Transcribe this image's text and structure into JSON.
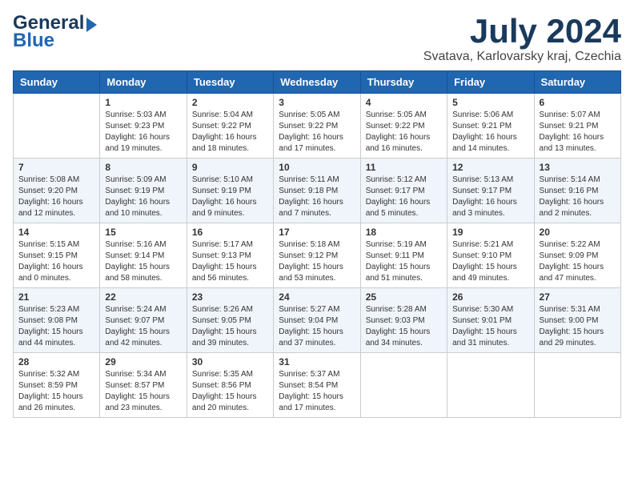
{
  "header": {
    "logo_line1": "General",
    "logo_line2": "Blue",
    "title": "July 2024",
    "subtitle": "Svatava, Karlovarsky kraj, Czechia"
  },
  "days_of_week": [
    "Sunday",
    "Monday",
    "Tuesday",
    "Wednesday",
    "Thursday",
    "Friday",
    "Saturday"
  ],
  "weeks": [
    [
      {
        "day": "",
        "sunrise": "",
        "sunset": "",
        "daylight": ""
      },
      {
        "day": "1",
        "sunrise": "Sunrise: 5:03 AM",
        "sunset": "Sunset: 9:23 PM",
        "daylight": "Daylight: 16 hours and 19 minutes."
      },
      {
        "day": "2",
        "sunrise": "Sunrise: 5:04 AM",
        "sunset": "Sunset: 9:22 PM",
        "daylight": "Daylight: 16 hours and 18 minutes."
      },
      {
        "day": "3",
        "sunrise": "Sunrise: 5:05 AM",
        "sunset": "Sunset: 9:22 PM",
        "daylight": "Daylight: 16 hours and 17 minutes."
      },
      {
        "day": "4",
        "sunrise": "Sunrise: 5:05 AM",
        "sunset": "Sunset: 9:22 PM",
        "daylight": "Daylight: 16 hours and 16 minutes."
      },
      {
        "day": "5",
        "sunrise": "Sunrise: 5:06 AM",
        "sunset": "Sunset: 9:21 PM",
        "daylight": "Daylight: 16 hours and 14 minutes."
      },
      {
        "day": "6",
        "sunrise": "Sunrise: 5:07 AM",
        "sunset": "Sunset: 9:21 PM",
        "daylight": "Daylight: 16 hours and 13 minutes."
      }
    ],
    [
      {
        "day": "7",
        "sunrise": "Sunrise: 5:08 AM",
        "sunset": "Sunset: 9:20 PM",
        "daylight": "Daylight: 16 hours and 12 minutes."
      },
      {
        "day": "8",
        "sunrise": "Sunrise: 5:09 AM",
        "sunset": "Sunset: 9:19 PM",
        "daylight": "Daylight: 16 hours and 10 minutes."
      },
      {
        "day": "9",
        "sunrise": "Sunrise: 5:10 AM",
        "sunset": "Sunset: 9:19 PM",
        "daylight": "Daylight: 16 hours and 9 minutes."
      },
      {
        "day": "10",
        "sunrise": "Sunrise: 5:11 AM",
        "sunset": "Sunset: 9:18 PM",
        "daylight": "Daylight: 16 hours and 7 minutes."
      },
      {
        "day": "11",
        "sunrise": "Sunrise: 5:12 AM",
        "sunset": "Sunset: 9:17 PM",
        "daylight": "Daylight: 16 hours and 5 minutes."
      },
      {
        "day": "12",
        "sunrise": "Sunrise: 5:13 AM",
        "sunset": "Sunset: 9:17 PM",
        "daylight": "Daylight: 16 hours and 3 minutes."
      },
      {
        "day": "13",
        "sunrise": "Sunrise: 5:14 AM",
        "sunset": "Sunset: 9:16 PM",
        "daylight": "Daylight: 16 hours and 2 minutes."
      }
    ],
    [
      {
        "day": "14",
        "sunrise": "Sunrise: 5:15 AM",
        "sunset": "Sunset: 9:15 PM",
        "daylight": "Daylight: 16 hours and 0 minutes."
      },
      {
        "day": "15",
        "sunrise": "Sunrise: 5:16 AM",
        "sunset": "Sunset: 9:14 PM",
        "daylight": "Daylight: 15 hours and 58 minutes."
      },
      {
        "day": "16",
        "sunrise": "Sunrise: 5:17 AM",
        "sunset": "Sunset: 9:13 PM",
        "daylight": "Daylight: 15 hours and 56 minutes."
      },
      {
        "day": "17",
        "sunrise": "Sunrise: 5:18 AM",
        "sunset": "Sunset: 9:12 PM",
        "daylight": "Daylight: 15 hours and 53 minutes."
      },
      {
        "day": "18",
        "sunrise": "Sunrise: 5:19 AM",
        "sunset": "Sunset: 9:11 PM",
        "daylight": "Daylight: 15 hours and 51 minutes."
      },
      {
        "day": "19",
        "sunrise": "Sunrise: 5:21 AM",
        "sunset": "Sunset: 9:10 PM",
        "daylight": "Daylight: 15 hours and 49 minutes."
      },
      {
        "day": "20",
        "sunrise": "Sunrise: 5:22 AM",
        "sunset": "Sunset: 9:09 PM",
        "daylight": "Daylight: 15 hours and 47 minutes."
      }
    ],
    [
      {
        "day": "21",
        "sunrise": "Sunrise: 5:23 AM",
        "sunset": "Sunset: 9:08 PM",
        "daylight": "Daylight: 15 hours and 44 minutes."
      },
      {
        "day": "22",
        "sunrise": "Sunrise: 5:24 AM",
        "sunset": "Sunset: 9:07 PM",
        "daylight": "Daylight: 15 hours and 42 minutes."
      },
      {
        "day": "23",
        "sunrise": "Sunrise: 5:26 AM",
        "sunset": "Sunset: 9:05 PM",
        "daylight": "Daylight: 15 hours and 39 minutes."
      },
      {
        "day": "24",
        "sunrise": "Sunrise: 5:27 AM",
        "sunset": "Sunset: 9:04 PM",
        "daylight": "Daylight: 15 hours and 37 minutes."
      },
      {
        "day": "25",
        "sunrise": "Sunrise: 5:28 AM",
        "sunset": "Sunset: 9:03 PM",
        "daylight": "Daylight: 15 hours and 34 minutes."
      },
      {
        "day": "26",
        "sunrise": "Sunrise: 5:30 AM",
        "sunset": "Sunset: 9:01 PM",
        "daylight": "Daylight: 15 hours and 31 minutes."
      },
      {
        "day": "27",
        "sunrise": "Sunrise: 5:31 AM",
        "sunset": "Sunset: 9:00 PM",
        "daylight": "Daylight: 15 hours and 29 minutes."
      }
    ],
    [
      {
        "day": "28",
        "sunrise": "Sunrise: 5:32 AM",
        "sunset": "Sunset: 8:59 PM",
        "daylight": "Daylight: 15 hours and 26 minutes."
      },
      {
        "day": "29",
        "sunrise": "Sunrise: 5:34 AM",
        "sunset": "Sunset: 8:57 PM",
        "daylight": "Daylight: 15 hours and 23 minutes."
      },
      {
        "day": "30",
        "sunrise": "Sunrise: 5:35 AM",
        "sunset": "Sunset: 8:56 PM",
        "daylight": "Daylight: 15 hours and 20 minutes."
      },
      {
        "day": "31",
        "sunrise": "Sunrise: 5:37 AM",
        "sunset": "Sunset: 8:54 PM",
        "daylight": "Daylight: 15 hours and 17 minutes."
      },
      {
        "day": "",
        "sunrise": "",
        "sunset": "",
        "daylight": ""
      },
      {
        "day": "",
        "sunrise": "",
        "sunset": "",
        "daylight": ""
      },
      {
        "day": "",
        "sunrise": "",
        "sunset": "",
        "daylight": ""
      }
    ]
  ]
}
